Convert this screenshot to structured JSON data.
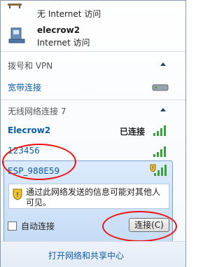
{
  "top_partial": {
    "label": "",
    "status": "无 Internet 访问"
  },
  "connection": {
    "name": "elecrow2",
    "status": "Internet 访问"
  },
  "dialup_section": {
    "header": "拨号和 VPN",
    "item": "宽带连接"
  },
  "wireless_section": {
    "header": "无线网络连接 7",
    "networks": [
      {
        "name": "Elecrow2",
        "status": "已连接"
      },
      {
        "name": "123456",
        "status": ""
      },
      {
        "name": "ESP_988E59",
        "status": ""
      }
    ]
  },
  "warning_text_line1": "通过此网络发送的信息可能对其他人",
  "warning_text_line2": "可见。",
  "auto_connect_label": "自动连接",
  "connect_button": "连接(C)",
  "footer_link": "打开网络和共享中心",
  "colors": {
    "link": "#0a5ca8",
    "highlight_ellipse": "#ee1111",
    "signal": "#3aa13a"
  }
}
